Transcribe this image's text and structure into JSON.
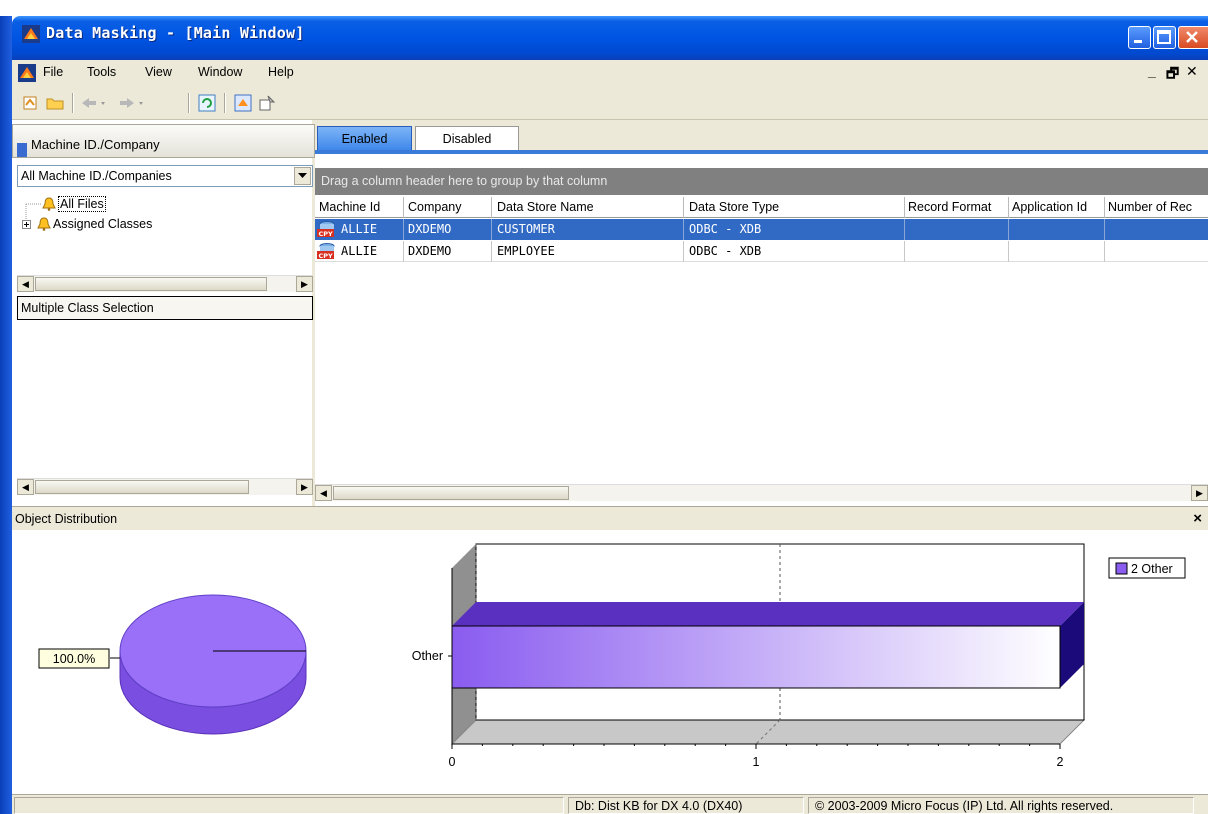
{
  "window": {
    "title": "Data Masking - [Main Window]",
    "controls": [
      "minimize",
      "maximize",
      "close"
    ]
  },
  "menu": {
    "items": [
      "File",
      "Tools",
      "View",
      "Window",
      "Help"
    ],
    "mdi_controls": [
      "_",
      "🗗",
      "✕"
    ]
  },
  "toolbar": {
    "icons": [
      "open-icon",
      "folder-icon",
      "back-icon",
      "forward-icon",
      "refresh-icon",
      "mask-icon",
      "properties-icon"
    ]
  },
  "left_pane": {
    "header": "Machine ID./Company",
    "combo_value": "All Machine ID./Companies",
    "tree": [
      {
        "label": "All Files",
        "selected": true
      },
      {
        "label": "Assigned Classes",
        "expandable": true
      }
    ],
    "multi_class_label": "Multiple Class Selection"
  },
  "right_pane": {
    "tabs": [
      {
        "label": "Enabled",
        "active": true
      },
      {
        "label": "Disabled",
        "active": false
      }
    ],
    "group_hint": "Drag a column header here to group by that column",
    "columns": [
      "Machine Id",
      "Company",
      "Data Store Name",
      "Data Store Type",
      "Record Format",
      "Application Id",
      "Number of Rec"
    ],
    "rows": [
      {
        "machine_id": "ALLIE",
        "company": "DXDEMO",
        "data_store_name": "CUSTOMER",
        "data_store_type": "ODBC - XDB",
        "selected": true
      },
      {
        "machine_id": "ALLIE",
        "company": "DXDEMO",
        "data_store_name": "EMPLOYEE",
        "data_store_type": "ODBC - XDB",
        "selected": false
      }
    ]
  },
  "object_distribution": {
    "title": "Object Distribution",
    "close_label": "×"
  },
  "chart_data": [
    {
      "type": "pie",
      "categories": [
        "Other"
      ],
      "values": [
        100
      ],
      "data_labels": [
        "100.0%"
      ],
      "colors": [
        "#8a5cf0"
      ]
    },
    {
      "type": "bar",
      "orientation": "horizontal",
      "categories": [
        "Other"
      ],
      "values": [
        2
      ],
      "xlim": [
        0,
        2
      ],
      "x_ticks": [
        "0",
        "1",
        "2"
      ],
      "legend": [
        {
          "label": "2 Other",
          "color": "#8a5cf0"
        }
      ],
      "legend_position": "top-right",
      "grid": true
    }
  ],
  "status_bar": {
    "db": "Db: Dist KB for DX 4.0 (DX40)",
    "copyright": "© 2003-2009 Micro Focus (IP) Ltd. All rights reserved."
  }
}
